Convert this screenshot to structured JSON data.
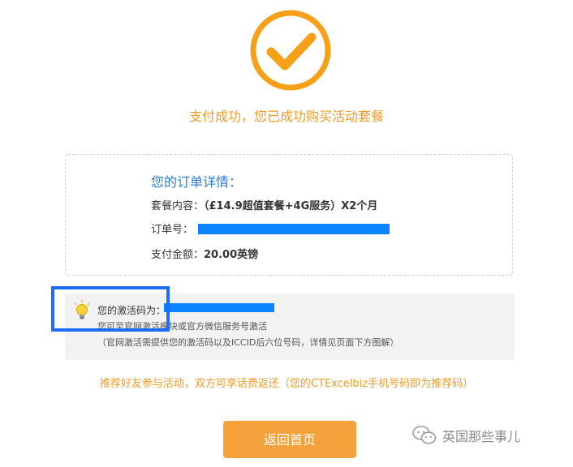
{
  "header": {
    "success_message": "支付成功，您已成功购买活动套餐"
  },
  "order": {
    "title": "您的订单详情：",
    "package_label": "套餐内容：",
    "package_value": "（£14.9超值套餐+4G服务）X2个月",
    "order_no_label": "订单号：",
    "amount_label": "支付金额：",
    "amount_value": "20.00英镑"
  },
  "activation": {
    "label": "您的激活码为：",
    "desc": "您可至官网激活模块或官方微信服务号激活",
    "note": "（官网激活需提供您的激活码以及ICCID后六位号码，详情见页面下方图解）"
  },
  "referral": {
    "text": "推荐好友参与活动，双方可享话费返还（您的CTExcelbiz手机号码即为推荐码）"
  },
  "actions": {
    "home_label": "返回首页"
  },
  "watermark": {
    "text": "英国那些事儿"
  },
  "colors": {
    "accent_orange": "#f29b27",
    "title_blue": "#2e7ad1",
    "redaction_blue": "#0a84ff",
    "highlight_blue": "#1e6bff"
  },
  "icons": {
    "success": "check-circle-icon",
    "tip": "lightbulb-icon",
    "watermark": "wechat-icon"
  }
}
